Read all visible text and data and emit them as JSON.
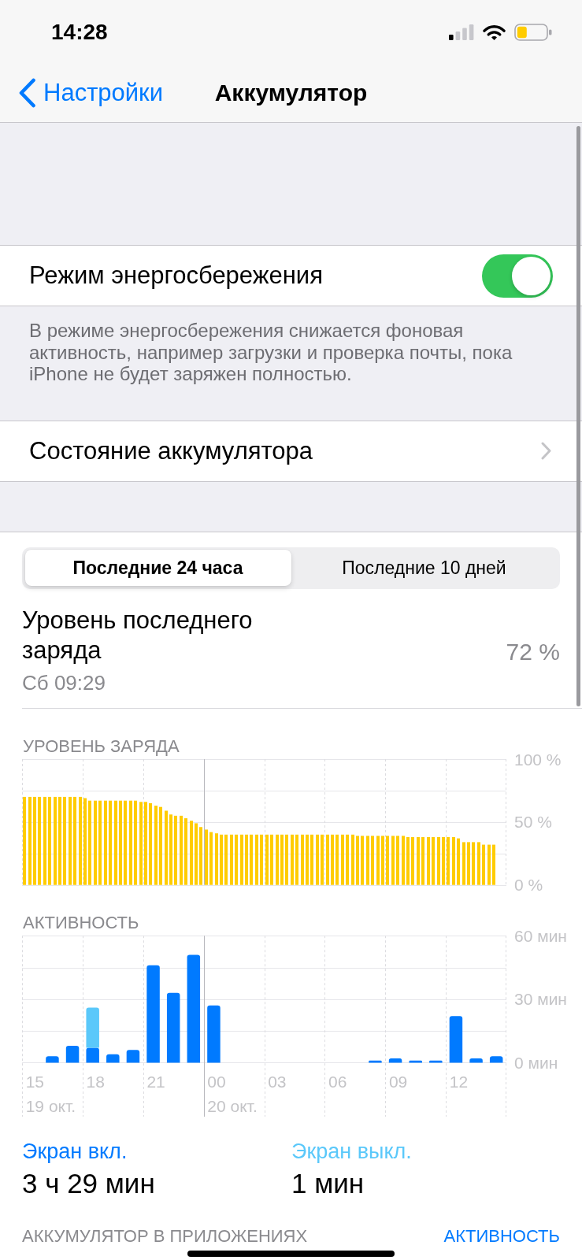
{
  "status_bar": {
    "time": "14:28"
  },
  "nav": {
    "back": "Настройки",
    "title": "Аккумулятор"
  },
  "power_saving": {
    "label": "Режим энергосбережения",
    "on": true,
    "footer": "В режиме энергосбережения снижается фоновая активность, например загрузки и проверка почты, пока iPhone не будет заряжен полностью."
  },
  "battery_health": {
    "label": "Состояние аккумулятора"
  },
  "period_tabs": [
    {
      "label": "Последние 24 часа",
      "selected": true
    },
    {
      "label": "Последние 10 дней",
      "selected": false
    }
  ],
  "last_charge": {
    "label": "Уровень последнего заряда",
    "time": "Сб 09:29",
    "value": "72 %"
  },
  "battery_level": {
    "chart_data": {
      "type": "bar",
      "title": "УРОВЕНЬ ЗАРЯДА",
      "ylim": [
        0,
        100
      ],
      "yticks": [
        {
          "value": 0,
          "label": "0 %"
        },
        {
          "value": 50,
          "label": "50 %"
        },
        {
          "value": 100,
          "label": "100 %"
        }
      ],
      "values": [
        70,
        70,
        70,
        70,
        70,
        70,
        70,
        70,
        70,
        70,
        70,
        70,
        69,
        67,
        67,
        67,
        67,
        67,
        67,
        67,
        67,
        67,
        67,
        66,
        66,
        65,
        63,
        62,
        59,
        56,
        55,
        55,
        53,
        51,
        49,
        46,
        44,
        42,
        41,
        40,
        40,
        40,
        40,
        40,
        40,
        40,
        40,
        40,
        40,
        40,
        40,
        40,
        40,
        40,
        40,
        40,
        40,
        40,
        40,
        40,
        40,
        40,
        40,
        40,
        40,
        40,
        39,
        39,
        39,
        39,
        39,
        39,
        39,
        39,
        39,
        39,
        38,
        38,
        38,
        38,
        38,
        38,
        38,
        38,
        38,
        38,
        37,
        34,
        34,
        34,
        34,
        32,
        32,
        32,
        null,
        null
      ]
    }
  },
  "activity": {
    "chart_data": {
      "type": "bar",
      "title": "АКТИВНОСТЬ",
      "stacked": true,
      "ylim": [
        0,
        60
      ],
      "yticks": [
        {
          "value": 0,
          "label": "0 мин"
        },
        {
          "value": 30,
          "label": "30 мин"
        },
        {
          "value": 60,
          "label": "60 мин"
        }
      ],
      "series": [
        {
          "name": "Экран вкл.",
          "color": "#007aff",
          "values": [
            0,
            3,
            8,
            7,
            4,
            6,
            46,
            33,
            51,
            27,
            0,
            0,
            0,
            0,
            0,
            0,
            0,
            1,
            2,
            1,
            1,
            22,
            2,
            3
          ]
        },
        {
          "name": "Экран выкл.",
          "color": "#5ac8fa",
          "values": [
            0,
            0,
            0,
            19,
            0,
            0,
            0,
            0,
            0,
            0,
            0,
            0,
            0,
            0,
            0,
            0,
            0,
            0,
            0,
            0,
            0,
            0,
            0,
            0
          ]
        }
      ]
    },
    "timeline": [
      {
        "date": "19 окт.",
        "hours": [
          "15",
          "18",
          "21"
        ]
      },
      {
        "date": "20 окт.",
        "hours": [
          "00",
          "03",
          "06",
          "09",
          "12"
        ]
      }
    ],
    "totals": [
      "3 ч 29 мин",
      "1 мин"
    ]
  },
  "apps_section": {
    "title": "АККУМУЛЯТОР В ПРИЛОЖЕНИЯХ",
    "action": "АКТИВНОСТЬ"
  }
}
